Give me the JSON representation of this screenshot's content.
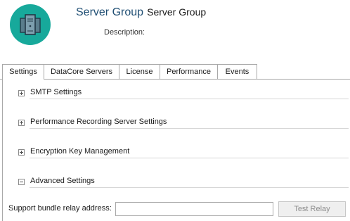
{
  "header": {
    "icon": "server-group-icon",
    "title_main": "Server Group",
    "title_sub": "Server Group",
    "description_label": "Description:"
  },
  "tabs": [
    {
      "label": "Settings",
      "active": true
    },
    {
      "label": "DataCore Servers",
      "active": false
    },
    {
      "label": "License",
      "active": false
    },
    {
      "label": "Performance",
      "active": false
    },
    {
      "label": "Events",
      "active": false
    }
  ],
  "sections": [
    {
      "label": "SMTP Settings",
      "expanded": false
    },
    {
      "label": "Performance Recording Server Settings",
      "expanded": false
    },
    {
      "label": "Encryption Key Management",
      "expanded": false
    },
    {
      "label": "Advanced Settings",
      "expanded": true
    }
  ],
  "advanced": {
    "relay_label": "Support bundle relay address:",
    "relay_value": "",
    "test_button_label": "Test Relay",
    "test_button_enabled": false
  },
  "colors": {
    "accent": "#17a99b",
    "title": "#1f4e73",
    "border": "#a9a9a9"
  }
}
